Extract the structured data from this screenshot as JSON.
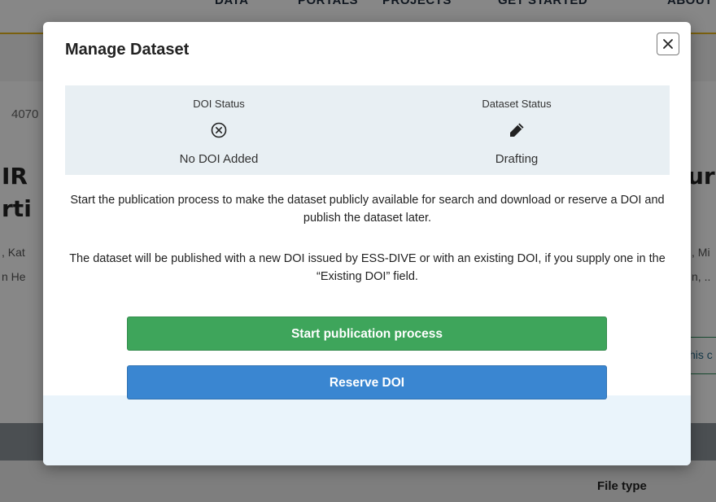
{
  "background": {
    "nav_items": [
      "DATA",
      "PORTALS",
      "PROJECTS",
      "GET STARTED",
      "ABOUT"
    ],
    "dataset_id_fragment": "4070",
    "title_fragments_left": [
      "IR",
      "rti"
    ],
    "title_fragments_right": [
      "ur"
    ],
    "author_fragments_left": [
      ", Kat",
      "n He"
    ],
    "author_fragments_right": [
      ", Mi",
      "n, .."
    ],
    "outline_button_fragment": "his c",
    "table_header": "File type"
  },
  "modal": {
    "title": "Manage Dataset",
    "close_icon": "close-x-icon",
    "doi_status": {
      "label": "DOI Status",
      "icon": "circle-x-icon",
      "value": "No DOI Added"
    },
    "dataset_status": {
      "label": "Dataset Status",
      "icon": "pencil-icon",
      "value": "Drafting"
    },
    "description_1": "Start the publication process to make the dataset publicly available for search and download or reserve a DOI and publish the dataset later.",
    "description_2": "The dataset will be published with a new DOI issued by ESS-DIVE or with an existing DOI, if you supply one in the “Existing DOI” field.",
    "start_button_label": "Start publication process",
    "reserve_button_label": "Reserve DOI",
    "colors": {
      "start_button": "#3ea55b",
      "reserve_button": "#3a86d1",
      "status_panel": "#e8eff3"
    }
  }
}
